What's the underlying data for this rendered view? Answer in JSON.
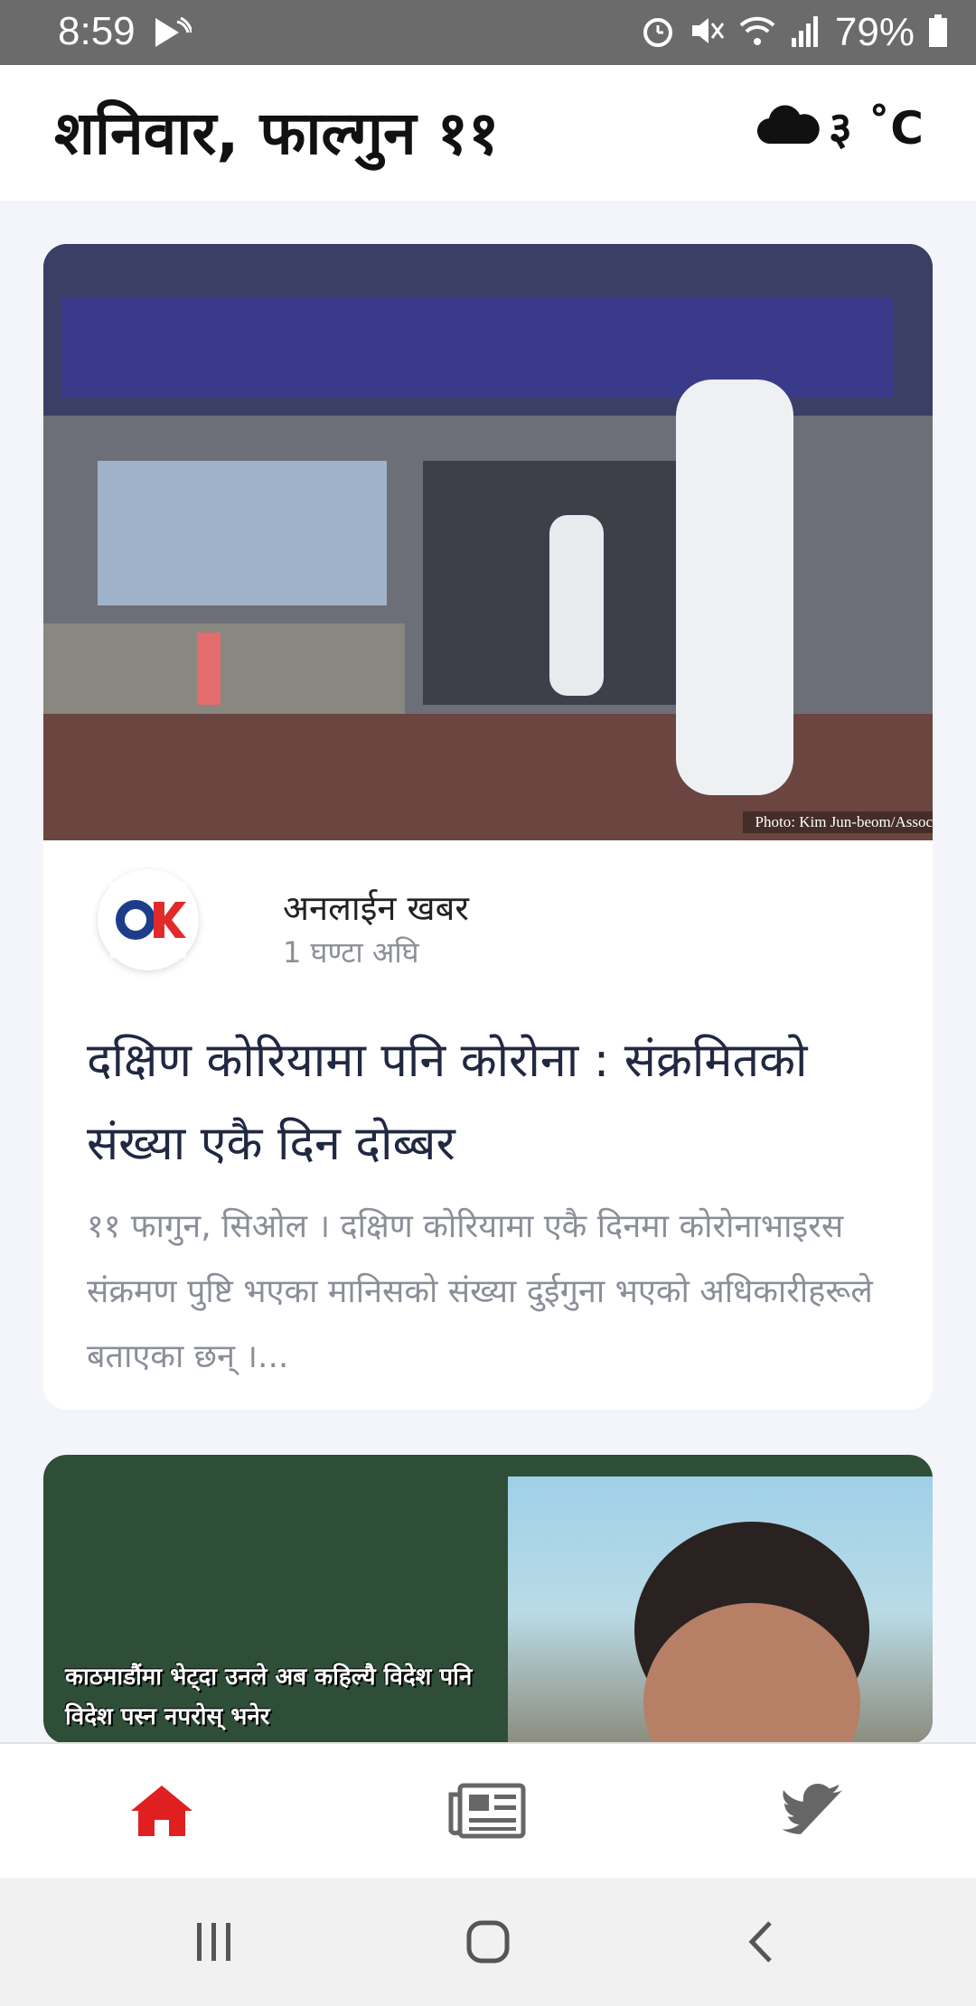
{
  "status_bar": {
    "time": "8:59",
    "battery": "79%",
    "icons": [
      "cast-icon",
      "alarm-icon",
      "mute-icon",
      "wifi-icon",
      "signal-icon",
      "battery-icon"
    ]
  },
  "header": {
    "date": "शनिवार, फाल्गुन ११",
    "weather_temp": "३ ˚C",
    "weather_icon": "cloud-icon"
  },
  "articles": [
    {
      "photo_credit": "Photo: Kim Jun-beom/Assoc",
      "source_name": "अनलाईन खबर",
      "time_ago": "1 घण्टा अघि",
      "headline": "दक्षिण कोरियामा पनि कोरोना : संक्रमितको संख्या एकै दिन दोब्बर",
      "summary": "११ फागुन, सिओल । दक्षिण कोरियामा एकै दिनमा कोरोनाभाइरस संक्रमण पुष्टि भएका मानिसको संख्या दुईगुना भएको अधिकारीहरूले बताएका छन् ।..."
    },
    {
      "image_caption": "काठमाडौंमा भेट्दा उनले अब कहिल्यै विदेश पनि विदेश पस्न नपरोस् भनेर"
    }
  ],
  "bottom_nav": {
    "items": [
      "home-icon",
      "news-icon",
      "twitter-icon"
    ],
    "active": "home-icon",
    "active_color": "#e02020",
    "inactive_color": "#666666"
  },
  "system_nav": [
    "recents-icon",
    "home-circle-icon",
    "back-icon"
  ]
}
